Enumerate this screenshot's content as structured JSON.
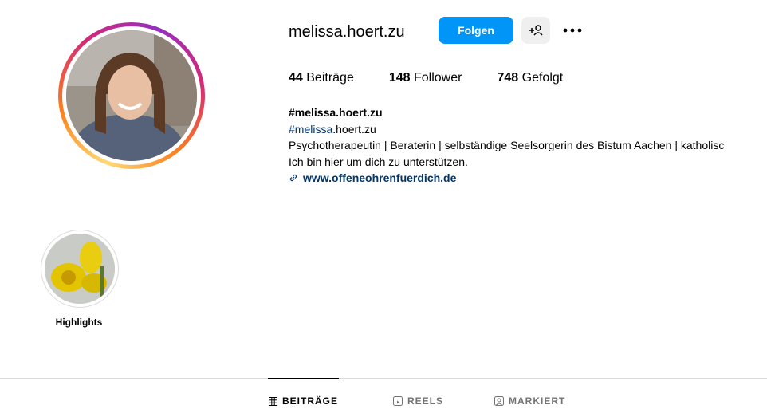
{
  "profile": {
    "username": "melissa.hoert.zu",
    "follow_label": "Folgen"
  },
  "stats": {
    "posts_count": "44",
    "posts_label": "Beiträge",
    "followers_count": "148",
    "followers_label": "Follower",
    "following_count": "748",
    "following_label": "Gefolgt"
  },
  "bio": {
    "name": "#melissa.hoert.zu",
    "hashtag": "#melissa",
    "hashtag_rest": ".hoert.zu",
    "line1": "Psychotherapeutin | Beraterin | selbständige Seelsorgerin des Bistum Aachen | katholisc",
    "line2": "Ich bin hier um dich zu unterstützen.",
    "link": "www.offeneohrenfuerdich.de"
  },
  "highlights": [
    {
      "label": "Highlights"
    }
  ],
  "tabs": [
    {
      "label": "BEITRÄGE",
      "icon": "grid-icon",
      "active": true
    },
    {
      "label": "REELS",
      "icon": "reels-icon",
      "active": false
    },
    {
      "label": "MARKIERT",
      "icon": "tagged-icon",
      "active": false
    }
  ],
  "colors": {
    "primary": "#0095f6",
    "link": "#00376b",
    "muted": "#737373"
  }
}
